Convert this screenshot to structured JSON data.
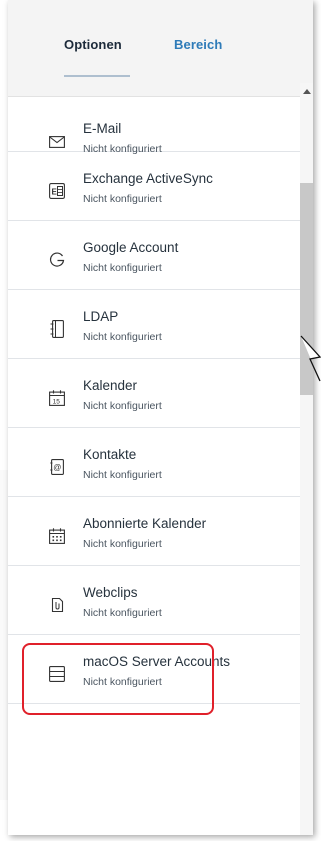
{
  "tabs": {
    "optionen": "Optionen",
    "bereich": "Bereich"
  },
  "items": [
    {
      "title": "E-Mail",
      "status": "Nicht konfiguriert",
      "icon": "envelope-icon"
    },
    {
      "title": "Exchange ActiveSync",
      "status": "Nicht konfiguriert",
      "icon": "exchange-icon"
    },
    {
      "title": "Google Account",
      "status": "Nicht konfiguriert",
      "icon": "google-icon"
    },
    {
      "title": "LDAP",
      "status": "Nicht konfiguriert",
      "icon": "ldap-book-icon"
    },
    {
      "title": "Kalender",
      "status": "Nicht konfiguriert",
      "icon": "calendar-icon"
    },
    {
      "title": "Kontakte",
      "status": "Nicht konfiguriert",
      "icon": "contacts-icon"
    },
    {
      "title": "Abonnierte Kalender",
      "status": "Nicht konfiguriert",
      "icon": "subscribed-calendar-icon"
    },
    {
      "title": "Webclips",
      "status": "Nicht konfiguriert",
      "icon": "webclip-icon"
    },
    {
      "title": "macOS Server Accounts",
      "status": "Nicht konfiguriert",
      "icon": "server-icon"
    }
  ],
  "colors": {
    "highlight": "#e0202a",
    "tab_active": "#1c2a3a",
    "tab_inactive": "#2e7bb8"
  }
}
